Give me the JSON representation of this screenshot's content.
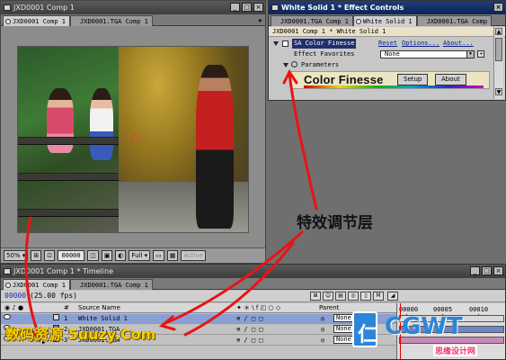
{
  "comp_window": {
    "title": "JXD0001 Comp 1",
    "tabs": [
      {
        "label": "JXD0001 Comp 1",
        "selected": true
      },
      {
        "label": "JXD0001.TGA Comp 1",
        "selected": false
      }
    ],
    "footer": {
      "zoom": "50%",
      "timecode": "00000",
      "resolution": "Full",
      "view": "Active"
    }
  },
  "effect_controls": {
    "title": "White Solid 1 * Effect Controls",
    "tabs": [
      {
        "label": "JXD0001.TGA Comp 1",
        "selected": false
      },
      {
        "label": "White Solid 1",
        "selected": true
      },
      {
        "label": "JXD0001.TGA Comp",
        "selected": false
      }
    ],
    "header": "JXD0001 Comp 1 * White Solid 1",
    "effect_name": "SA Color Finesse",
    "reset_label": "Reset",
    "options_label": "Options...",
    "about_label": "About...",
    "favorites_label": "Effect Favorites",
    "favorites_value": "None",
    "parameters_label": "Parameters",
    "plugin_title": "Color Finesse",
    "setup_button": "Setup",
    "about_button": "About"
  },
  "timeline": {
    "title": "JXD0001 Comp 1 * Timeline",
    "tabs": [
      {
        "label": "JXD0001 Comp 1",
        "selected": true
      },
      {
        "label": "JXD0001.TGA Comp 1",
        "selected": false
      }
    ],
    "current_time": "00000",
    "fps": "(25.00 fps)",
    "columns": {
      "source_name": "Source Name",
      "parent": "Parent"
    },
    "layers": [
      {
        "index": "1",
        "name": "White Solid 1",
        "parent": "None",
        "selected": true,
        "label_color": "#d9d9d9"
      },
      {
        "index": "2",
        "name": "JXD0001.TGA",
        "parent": "None",
        "selected": false,
        "label_color": "#6e86c8"
      },
      {
        "index": "3",
        "name": "JXD0001.TGA",
        "parent": "None",
        "selected": false,
        "label_color": "#c98ab5"
      }
    ],
    "ruler": [
      "00000",
      "00005",
      "00010"
    ]
  },
  "annotation": {
    "callout_text": "特效调节层"
  },
  "watermarks": {
    "left_text": "数码资源 5uuzy.Com",
    "logo_mark": "仁",
    "logo_text": "CGWT",
    "logo_sub": "思缘设计网"
  },
  "colors": {
    "arrow_red": "#e81414",
    "accent_blue": "#1d2aa8",
    "selected_layer": "#8aa0d4"
  }
}
